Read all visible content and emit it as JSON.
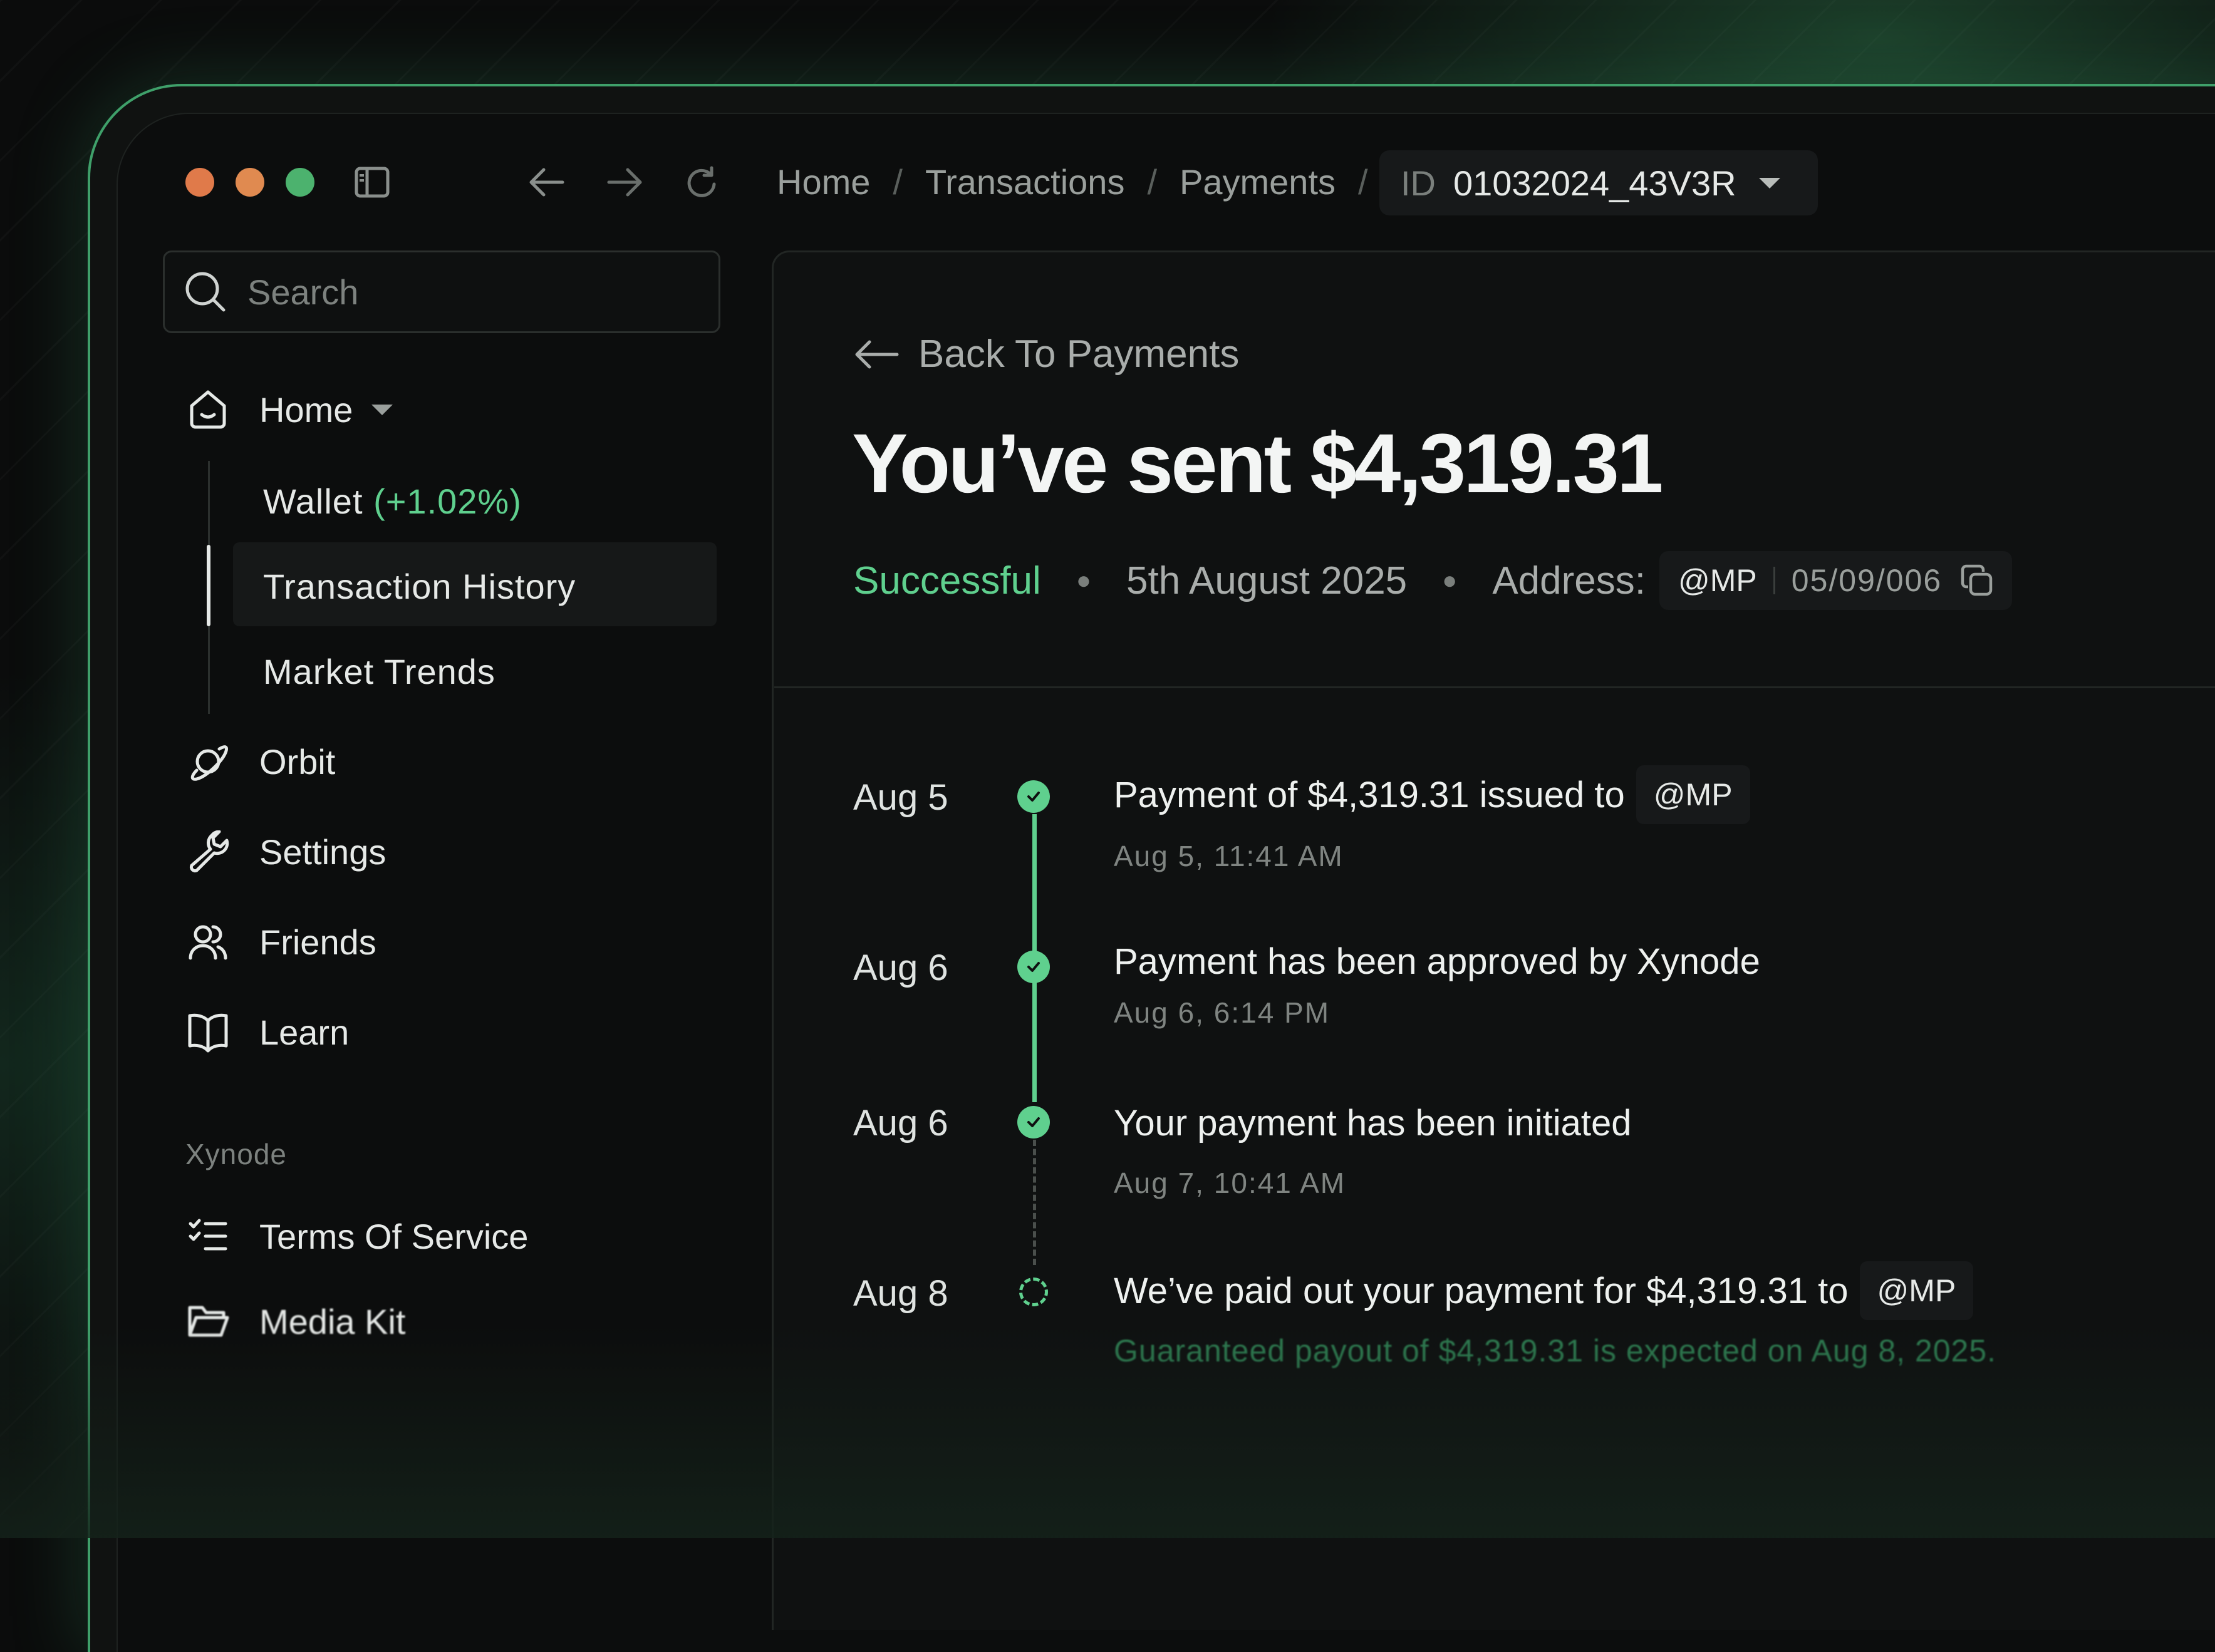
{
  "window": {
    "traffic_lights": [
      "#e07a4a",
      "#e08a50",
      "#4cb26e"
    ]
  },
  "breadcrumb": {
    "items": [
      "Home",
      "Transactions",
      "Payments"
    ],
    "separator": "/",
    "id_label": "ID",
    "id_value": "01032024_43V3R"
  },
  "sidebar": {
    "search_placeholder": "Search",
    "home": {
      "label": "Home"
    },
    "sub_items": {
      "wallet_label": "Wallet",
      "wallet_change": "(+1.02%)",
      "transaction_history": "Transaction History",
      "market_trends": "Market Trends"
    },
    "items": [
      {
        "label": "Orbit",
        "icon": "planet-icon"
      },
      {
        "label": "Settings",
        "icon": "wrench-icon"
      },
      {
        "label": "Friends",
        "icon": "users-icon"
      },
      {
        "label": "Learn",
        "icon": "book-icon"
      }
    ],
    "section_label": "Xynode",
    "section_items": [
      {
        "label": "Terms Of Service",
        "icon": "checklist-icon"
      },
      {
        "label": "Media Kit",
        "icon": "folder-icon"
      }
    ]
  },
  "main": {
    "back_label": "Back To Payments",
    "headline": "You’ve sent $4,319.31",
    "status": "Successful",
    "date": "5th August 2025",
    "address_label": "Address:",
    "address_handle": "@MP",
    "address_code": "05/09/006",
    "accent_color": "#5fd08e"
  },
  "timeline": [
    {
      "date": "Aug 5",
      "title": "Payment of $4,319.31 issued to",
      "tag": "@MP",
      "sub": "Aug 5, 11:41 AM",
      "done": true
    },
    {
      "date": "Aug 6",
      "title": "Payment has been approved by Xynode",
      "sub": "Aug 6, 6:14 PM",
      "done": true
    },
    {
      "date": "Aug 6",
      "title": "Your payment has been initiated",
      "sub": "Aug 7, 10:41 AM",
      "done": true
    },
    {
      "date": "Aug 8",
      "title": "We’ve paid out your payment for $4,319.31 to",
      "tag": "@MP",
      "sub": "Guaranteed payout of $4,319.31 is expected on Aug 8, 2025.",
      "done": false
    }
  ]
}
